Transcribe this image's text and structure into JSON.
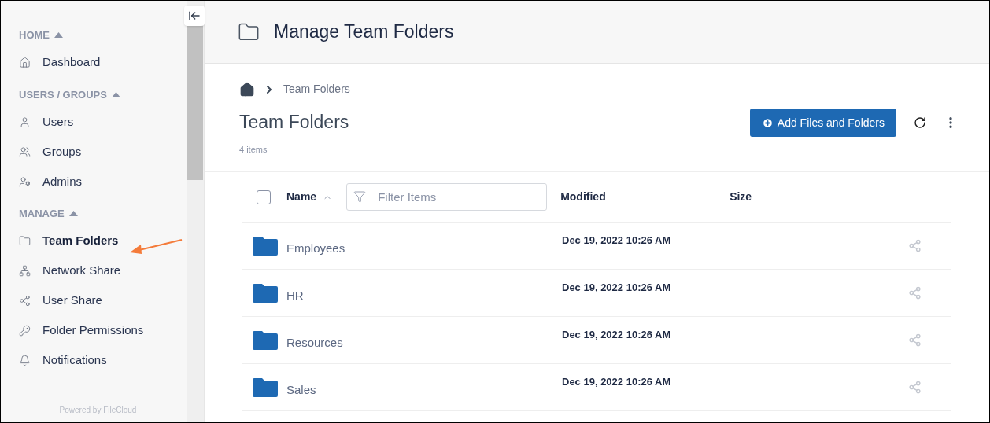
{
  "sidebar": {
    "sections": [
      {
        "title": "HOME",
        "expanded": true,
        "items": [
          {
            "label": "Dashboard",
            "selected": false
          }
        ]
      },
      {
        "title": "USERS / GROUPS",
        "expanded": true,
        "items": [
          {
            "label": "Users",
            "selected": false
          },
          {
            "label": "Groups",
            "selected": false
          },
          {
            "label": "Admins",
            "selected": false
          }
        ]
      },
      {
        "title": "MANAGE",
        "expanded": true,
        "items": [
          {
            "label": "Team Folders",
            "selected": true
          },
          {
            "label": "Network Share",
            "selected": false
          },
          {
            "label": "User Share",
            "selected": false
          },
          {
            "label": "Folder Permissions",
            "selected": false
          },
          {
            "label": "Notifications",
            "selected": false
          }
        ]
      }
    ],
    "footer": "Powered by FileCloud"
  },
  "header": {
    "title": "Manage Team Folders"
  },
  "breadcrumb": [
    "Team Folders"
  ],
  "page_title": "Team Folders",
  "item_count": "4 items",
  "add_button": "Add Files and Folders",
  "table": {
    "select_all_checked": false,
    "columns": [
      "Name",
      "Modified",
      "Size"
    ],
    "filter": {
      "placeholder": "Filter Items"
    },
    "rows": [
      {
        "name": "Employees",
        "modified": "Dec 19, 2022 10:26 AM"
      },
      {
        "name": "HR",
        "modified": "Dec 19, 2022 10:26 AM"
      },
      {
        "name": "Resources",
        "modified": "Dec 19, 2022 10:26 AM"
      },
      {
        "name": "Sales",
        "modified": "Dec 19, 2022 10:26 AM"
      }
    ]
  }
}
